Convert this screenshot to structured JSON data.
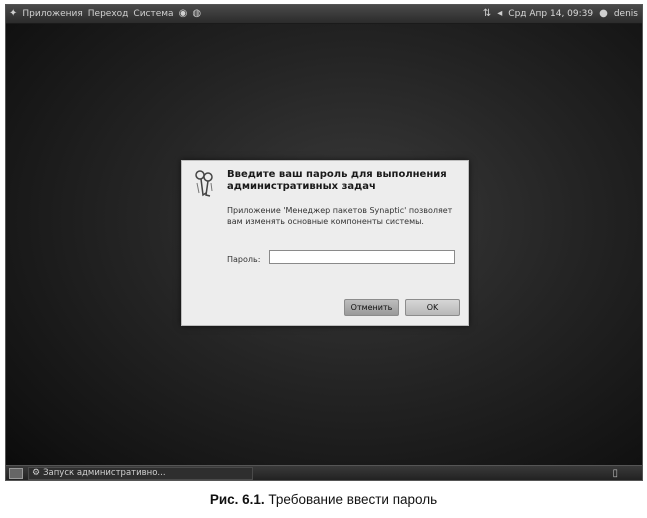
{
  "top_panel": {
    "menus": [
      "Приложения",
      "Переход",
      "Система"
    ],
    "datetime": "Срд Апр 14, 09:39",
    "user": "denis"
  },
  "dialog": {
    "title": "Введите ваш пароль для выполнения административных задач",
    "message": "Приложение 'Менеджер пакетов Synaptic' позволяет вам изменять основные компоненты системы.",
    "password_label": "Пароль:",
    "password_value": "",
    "cancel_label": "Отменить",
    "ok_label": "OK"
  },
  "bottom_panel": {
    "task_label": "Запуск административно..."
  },
  "caption": {
    "label": "Рис. 6.1.",
    "text": " Требование ввести пароль"
  }
}
